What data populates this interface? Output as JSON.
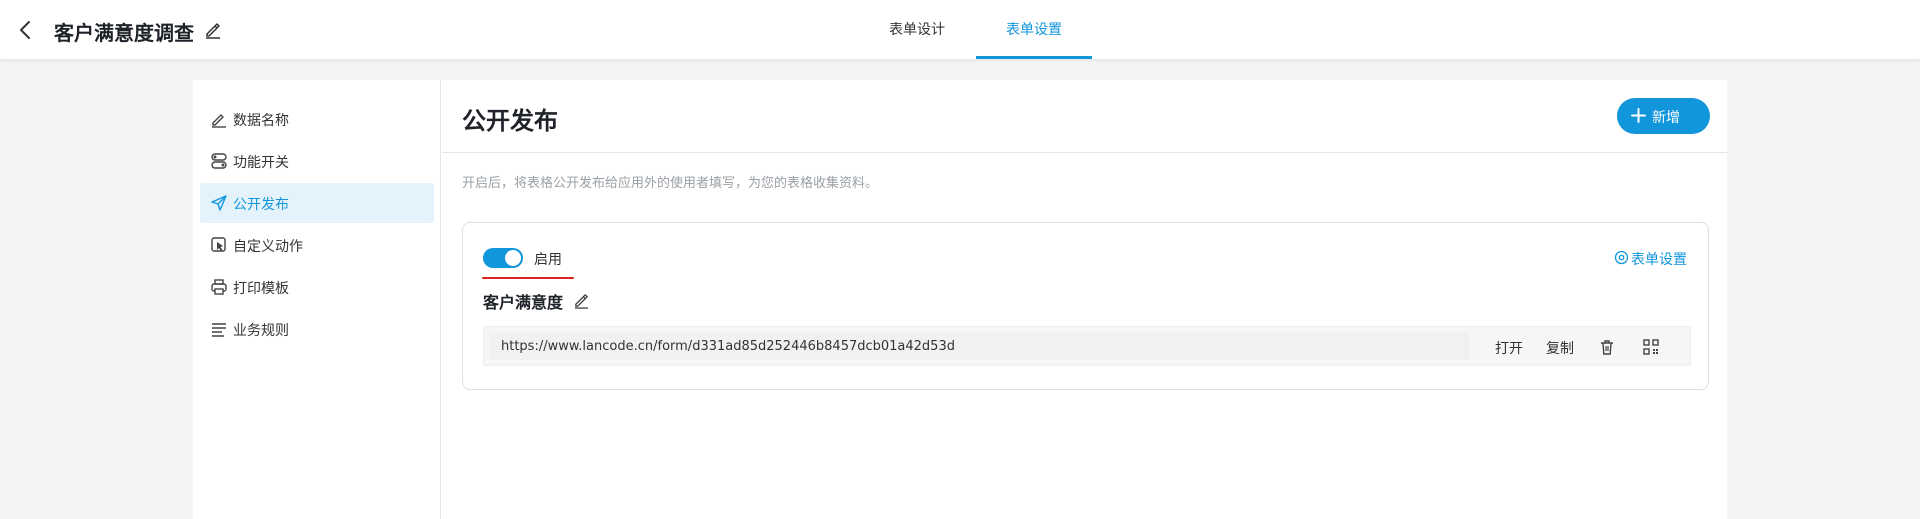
{
  "header": {
    "title": "客户满意度调查",
    "tabs": [
      {
        "label": "表单设计"
      },
      {
        "label": "表单设置"
      }
    ],
    "active_tab": "表单设置"
  },
  "sidebar": {
    "items": [
      {
        "label": "数据名称",
        "icon": "pencil-icon"
      },
      {
        "label": "功能开关",
        "icon": "switch-icon"
      },
      {
        "label": "公开发布",
        "icon": "send-icon"
      },
      {
        "label": "自定义动作",
        "icon": "cursor-icon"
      },
      {
        "label": "打印模板",
        "icon": "printer-icon"
      },
      {
        "label": "业务规则",
        "icon": "lines-icon"
      }
    ],
    "active_item": "公开发布"
  },
  "main": {
    "title": "公开发布",
    "add_label": "新增",
    "description": "开启后，将表格公开发布给应用外的使用者填写，为您的表格收集资料。",
    "card": {
      "toggle_label": "启用",
      "toggle_on": true,
      "form_settings_label": "表单设置",
      "form_name": "客户满意度",
      "url": "https://www.lancode.cn/form/d331ad85d252446b8457dcb01a42d53d",
      "open_label": "打开",
      "copy_label": "复制"
    }
  },
  "colors": {
    "accent": "#1296db",
    "highlight_underline": "#e02020",
    "active_nav_bg": "#e3f2fb"
  }
}
